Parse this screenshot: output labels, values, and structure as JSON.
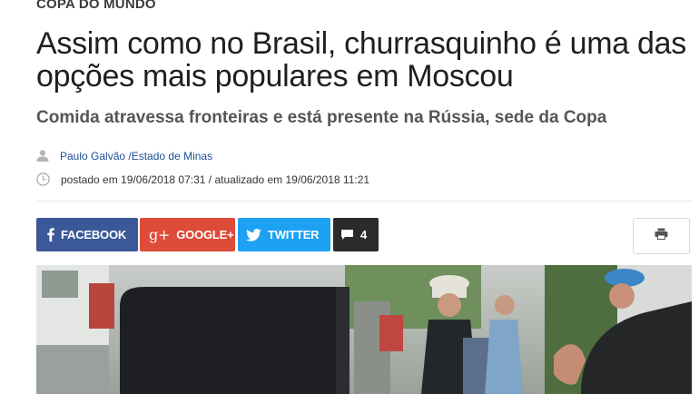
{
  "article": {
    "section": "COPA DO MUNDO",
    "title": "Assim como no Brasil, churrasquinho é uma das opções mais populares em Moscou",
    "subtitle": "Comida atravessa fronteiras e está presente na Rússia, sede da Copa",
    "author": "Paulo Galvão /Estado de Minas",
    "dates": "postado em 19/06/2018 07:31 / atualizado em 19/06/2018 11:21"
  },
  "share": {
    "facebook_label": "FACEBOOK",
    "googleplus_label": "GOOGLE+",
    "googleplus_glyph": "g+",
    "twitter_label": "TWITTER",
    "comments_count": "4"
  },
  "colors": {
    "facebook": "#3b5998",
    "googleplus": "#dd4b39",
    "twitter": "#1da1f2",
    "comments": "#2b2b2b",
    "author_link": "#1d4f91"
  },
  "icons": [
    "user-icon",
    "clock-icon",
    "facebook-icon",
    "googleplus-icon",
    "twitter-icon",
    "comment-icon",
    "print-icon"
  ]
}
